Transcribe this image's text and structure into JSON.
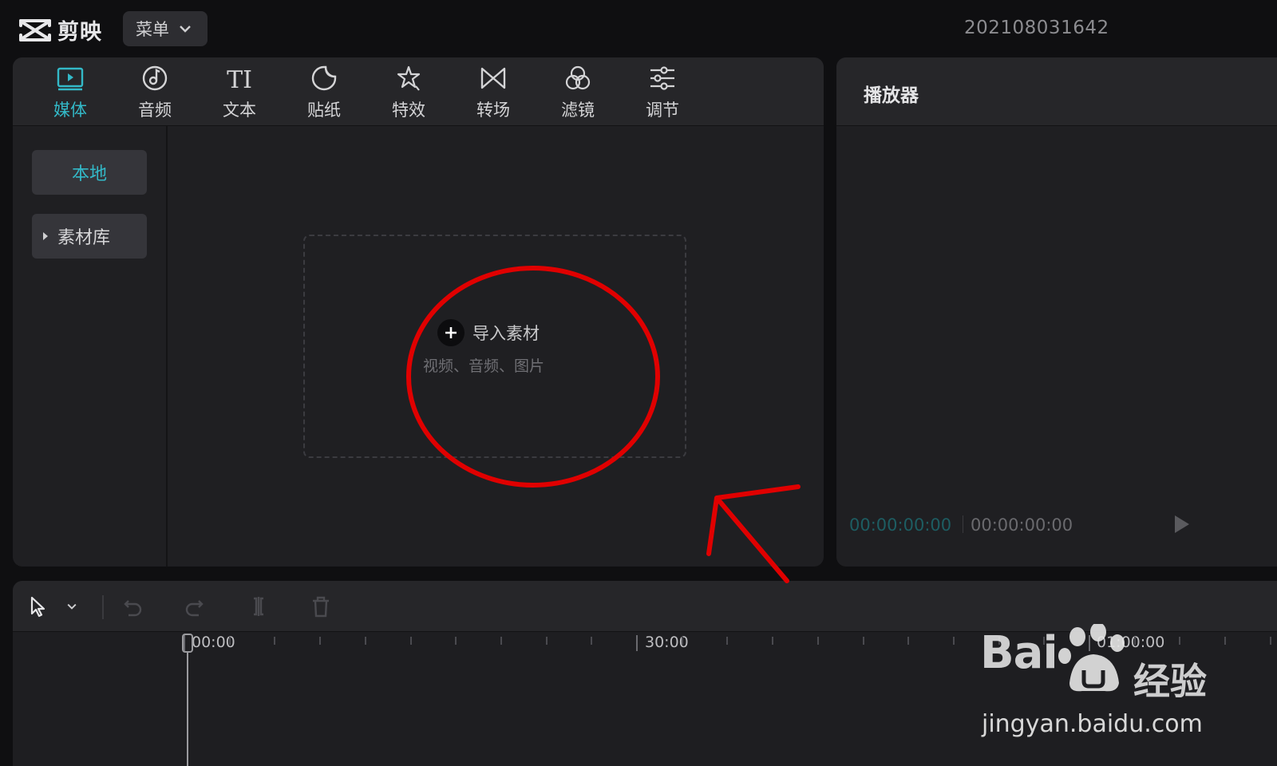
{
  "app": {
    "name": "剪映",
    "menu_label": "菜单",
    "project_name": "202108031642"
  },
  "toolbar": {
    "tabs": [
      {
        "label": "媒体",
        "icon": "media-icon",
        "active": true
      },
      {
        "label": "音频",
        "icon": "audio-icon",
        "active": false
      },
      {
        "label": "文本",
        "icon": "text-icon",
        "active": false
      },
      {
        "label": "贴纸",
        "icon": "sticker-icon",
        "active": false
      },
      {
        "label": "特效",
        "icon": "effects-icon",
        "active": false
      },
      {
        "label": "转场",
        "icon": "transition-icon",
        "active": false
      },
      {
        "label": "滤镜",
        "icon": "filter-icon",
        "active": false
      },
      {
        "label": "调节",
        "icon": "adjust-icon",
        "active": false
      }
    ],
    "text_icon_glyph": "TI"
  },
  "sidebar": {
    "items": [
      {
        "label": "本地",
        "active": true
      },
      {
        "label": "素材库",
        "active": false
      }
    ]
  },
  "import": {
    "label": "导入素材",
    "hint": "视频、音频、图片"
  },
  "player": {
    "title": "播放器",
    "current_time": "00:00:00:00",
    "total_time": "00:00:00:00"
  },
  "timeline": {
    "ruler_labels": [
      "00:00",
      "30:00",
      "01:00:00"
    ]
  },
  "annotations": {
    "circle_color": "#e00000",
    "arrow_color": "#e00000"
  },
  "watermark": {
    "brand": "Bai",
    "brand_suffix": "经验",
    "url": "jingyan.baidu.com"
  },
  "colors": {
    "accent": "#33b9c8",
    "background": "#0f0f11",
    "panel": "#1f1f22"
  }
}
